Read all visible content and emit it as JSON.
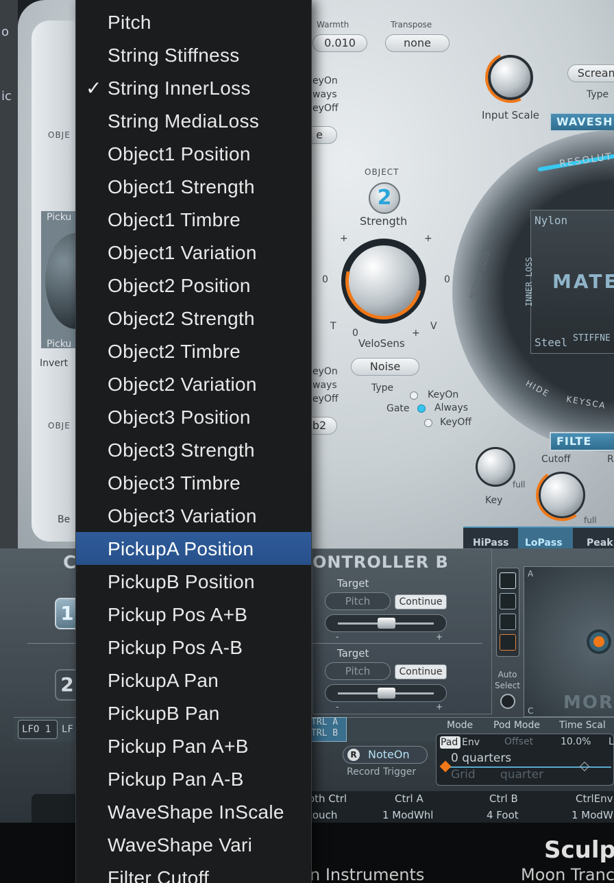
{
  "plugin": {
    "name": "Sculpt",
    "header_labels": {
      "warmth": "Warmth",
      "transpose": "Transpose"
    },
    "warmth_value": "0.010",
    "transpose_value": "none",
    "input_scale_label": "Input Scale",
    "scream_button": "Scream",
    "type_label": "Type",
    "waveshaper_tab": "WAVESH",
    "object_label": "OBJECT",
    "object_number": "2",
    "strength_label": "Strength",
    "velosens_label": "VeloSens",
    "knob_marks": {
      "plus": "+",
      "zero": "0",
      "t": "T",
      "v": "V"
    },
    "noise_button": "Noise",
    "type_label2": "Type",
    "gate_label": "Gate",
    "gate_options": [
      "KeyOn",
      "Always",
      "KeyOff"
    ],
    "gate_selected": "Always",
    "left_fragments": {
      "keyon_partial": "eyOn",
      "always_partial": "ways",
      "keyoff_partial": "eyOff",
      "keyon_partial2": "eyOn",
      "always_partial2": "ways",
      "keyoff_partial2": "eyOff",
      "e_partial": "e",
      "b2_partial": "b2",
      "obj1": "OBJE",
      "obj3": "OBJE",
      "picku_top": "Picku",
      "picku_bottom": "Picku",
      "invert": "Invert",
      "be": "Be"
    },
    "left_edge_fragments": [
      "o",
      "ic"
    ],
    "material": {
      "resolution": "RESOLUT",
      "nylon": "Nylon",
      "steel": "Steel",
      "inner_loss": "INNER LOSS",
      "media_loss": "MEDIA LOSS",
      "stiffness": "STIFFNE",
      "big_label": "MATER",
      "hide": "HIDE",
      "keyscale": "KEYSCA"
    },
    "filter_tab": "FILTE",
    "key_label": "Key",
    "full_label": "full",
    "cutoff_label": "Cutoff",
    "r_label": "R",
    "filter_types": [
      "HiPass",
      "LoPass",
      "Peak"
    ],
    "filter_selected": "LoPass",
    "controller_b": {
      "title": "ONTROLLER B",
      "c_letter": "C",
      "target_label": "Target",
      "rows": [
        {
          "number": "1",
          "target": "Pitch",
          "mode": "Continue"
        },
        {
          "number": "2",
          "target": "Pitch",
          "mode": "Continue"
        }
      ],
      "minus": "-",
      "plus": "+"
    },
    "auto_select": "Auto\nSelect",
    "morph_label": "MORP",
    "morph_corners": {
      "a": "A",
      "c": "C"
    },
    "lfo_labels": [
      "LFO 1",
      "LF"
    ],
    "ctrl_ab": "TRL A\nTRL B",
    "mode_bar": {
      "mode": "Mode",
      "pod_mode": "Pod Mode",
      "time_scale": "Time Scal"
    },
    "record_button": "NoteOn",
    "record_r": "R",
    "record_trigger": "Record Trigger",
    "envelope": {
      "pad": "Pad",
      "env": "Env",
      "offset_label": "Offset",
      "offset_value": "10.0%",
      "l_label": "L",
      "quarters": "0 quarters",
      "grid": "Grid",
      "quarter": "quarter"
    },
    "ctrl_row": {
      "headers": [
        "oth Ctrl",
        "Ctrl A",
        "Ctrl B",
        "CtrlEnv"
      ],
      "values": [
        "touch",
        "1 ModWhl",
        "4 Foot",
        "1 ModW"
      ]
    },
    "footer": {
      "left": "n Instruments",
      "right": "Moon Trance"
    },
    "accent_orange": "#f07818",
    "accent_cyan": "#39c8f0"
  },
  "menu": {
    "items": [
      {
        "label": "Pitch",
        "checked": false,
        "selected": false
      },
      {
        "label": "String Stiffness",
        "checked": false,
        "selected": false
      },
      {
        "label": "String InnerLoss",
        "checked": true,
        "selected": false
      },
      {
        "label": "String MediaLoss",
        "checked": false,
        "selected": false
      },
      {
        "label": "Object1 Position",
        "checked": false,
        "selected": false
      },
      {
        "label": "Object1 Strength",
        "checked": false,
        "selected": false
      },
      {
        "label": "Object1 Timbre",
        "checked": false,
        "selected": false
      },
      {
        "label": "Object1 Variation",
        "checked": false,
        "selected": false
      },
      {
        "label": "Object2 Position",
        "checked": false,
        "selected": false
      },
      {
        "label": "Object2 Strength",
        "checked": false,
        "selected": false
      },
      {
        "label": "Object2 Timbre",
        "checked": false,
        "selected": false
      },
      {
        "label": "Object2 Variation",
        "checked": false,
        "selected": false
      },
      {
        "label": "Object3 Position",
        "checked": false,
        "selected": false
      },
      {
        "label": "Object3 Strength",
        "checked": false,
        "selected": false
      },
      {
        "label": "Object3 Timbre",
        "checked": false,
        "selected": false
      },
      {
        "label": "Object3 Variation",
        "checked": false,
        "selected": false
      },
      {
        "label": "PickupA Position",
        "checked": false,
        "selected": true
      },
      {
        "label": "PickupB Position",
        "checked": false,
        "selected": false
      },
      {
        "label": "Pickup Pos A+B",
        "checked": false,
        "selected": false
      },
      {
        "label": "Pickup Pos A-B",
        "checked": false,
        "selected": false
      },
      {
        "label": "PickupA Pan",
        "checked": false,
        "selected": false
      },
      {
        "label": "PickupB Pan",
        "checked": false,
        "selected": false
      },
      {
        "label": "Pickup Pan A+B",
        "checked": false,
        "selected": false
      },
      {
        "label": "Pickup Pan A-B",
        "checked": false,
        "selected": false
      },
      {
        "label": "WaveShape InScale",
        "checked": false,
        "selected": false
      },
      {
        "label": "WaveShape Vari",
        "checked": false,
        "selected": false
      },
      {
        "label": "Filter Cutoff",
        "checked": false,
        "selected": false
      }
    ],
    "check_glyph": "✓",
    "selection_color": "#2f5b9a"
  }
}
